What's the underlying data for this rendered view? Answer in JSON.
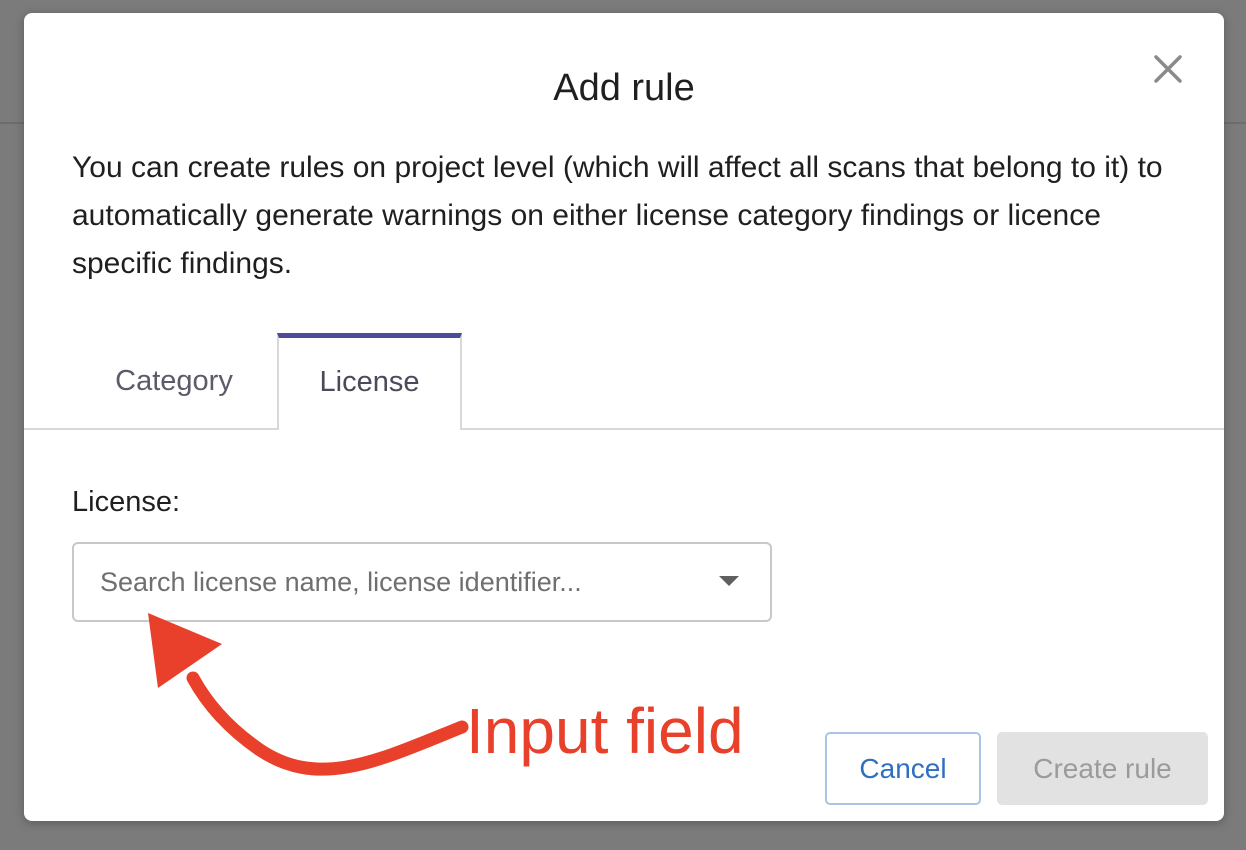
{
  "dialog": {
    "title": "Add rule",
    "description": "You can create rules on project level (which will affect all scans that belong to it) to automatically generate warnings on either license category findings or licence specific findings.",
    "close_icon": "close-icon"
  },
  "tabs": [
    {
      "label": "Category",
      "active": false
    },
    {
      "label": "License",
      "active": true
    }
  ],
  "form": {
    "license_label": "License:",
    "license_placeholder": "Search license name, license identifier...",
    "license_value": ""
  },
  "buttons": {
    "cancel_label": "Cancel",
    "create_label": "Create rule",
    "create_disabled": true
  },
  "annotation": {
    "text": "Input field",
    "color": "#e8402b"
  },
  "colors": {
    "active_tab_accent": "#4b4b9a",
    "cancel_text": "#2f6fc0"
  }
}
